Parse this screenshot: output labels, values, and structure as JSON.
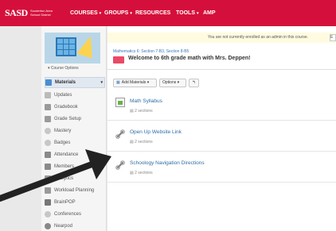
{
  "topbar": {
    "logo_main": "SASD",
    "logo_sub": "Souderton Area School District",
    "nav": [
      {
        "label": "COURSES"
      },
      {
        "label": "GROUPS"
      },
      {
        "label": "RESOURCES"
      },
      {
        "label": "TOOLS"
      },
      {
        "label": "AMP"
      }
    ],
    "brand_color": "#d50f3b"
  },
  "sidebar": {
    "course_options": "Course Options",
    "items": [
      {
        "label": "Materials",
        "icon": "folder-icon",
        "active": true
      },
      {
        "label": "Updates",
        "icon": "updates-icon"
      },
      {
        "label": "Gradebook",
        "icon": "gradebook-icon"
      },
      {
        "label": "Grade Setup",
        "icon": "grade-setup-icon"
      },
      {
        "label": "Mastery",
        "icon": "mastery-icon"
      },
      {
        "label": "Badges",
        "icon": "badges-icon"
      },
      {
        "label": "Attendance",
        "icon": "attendance-icon"
      },
      {
        "label": "Members",
        "icon": "members-icon"
      },
      {
        "label": "Analytics",
        "icon": "analytics-icon"
      },
      {
        "label": "Workload Planning",
        "icon": "workload-icon"
      },
      {
        "label": "BrainPOP",
        "icon": "brainpop-icon"
      },
      {
        "label": "Conferences",
        "icon": "conferences-icon"
      },
      {
        "label": "Nearpod",
        "icon": "nearpod-icon"
      }
    ]
  },
  "main": {
    "notice": "You are not currently enrolled as an admin in this course.",
    "notice_button": "E",
    "breadcrumb": "Mathematics 6: Section 7-B3, Section 8-B5",
    "title": "Welcome to 6th grade math with Mrs. Deppen!",
    "toolbar": {
      "add_materials": "Add Materials",
      "options": "Options"
    },
    "materials": [
      {
        "title": "Math Syllabus",
        "meta": "2 sections",
        "icon": "document-icon"
      },
      {
        "title": "Open Up Website Link",
        "meta": "2 sections",
        "icon": "link-icon"
      },
      {
        "title": "Schoology Navigation Directions",
        "meta": "2 sections",
        "icon": "link-icon"
      }
    ]
  }
}
